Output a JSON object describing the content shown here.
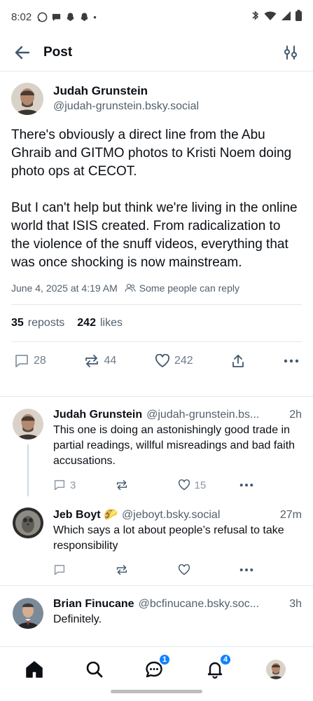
{
  "status_bar": {
    "time": "8:02",
    "dot": "•"
  },
  "header": {
    "title": "Post"
  },
  "main_post": {
    "author_name": "Judah Grunstein",
    "author_handle": "@judah-grunstein.bsky.social",
    "text": "There's obviously a direct line from the Abu Ghraib and GITMO photos to Kristi Noem doing photo ops at CECOT.\n\nBut I can't help but think we're living in the online world that ISIS created. From radicalization to the violence of the snuff videos, everything that was once shocking is now mainstream.",
    "timestamp": "June 4, 2025 at 4:19 AM",
    "reply_setting": "Some people can reply",
    "reposts_count": "35",
    "reposts_label": "reposts",
    "likes_count": "242",
    "likes_label": "likes",
    "actions": {
      "replies": "28",
      "reposts": "44",
      "likes": "242"
    }
  },
  "replies": [
    {
      "name": "Judah Grunstein",
      "handle": "@judah-grunstein.bs...",
      "time": "2h",
      "text": "This one is doing an astonishingly good trade in partial readings, willful misreadings and bad faith accusations.",
      "replies": "3",
      "reposts": "",
      "likes": "15"
    },
    {
      "name": "Jeb Boyt 🌮",
      "handle": "@jeboyt.bsky.social",
      "time": "27m",
      "text": "Which says a lot about people’s refusal to take responsibility",
      "replies": "",
      "reposts": "",
      "likes": ""
    },
    {
      "name": "Brian Finucane",
      "handle": "@bcfinucane.bsky.soc...",
      "time": "3h",
      "text": "Definitely."
    }
  ],
  "bottom_nav": {
    "messages_badge": "1",
    "notifications_badge": "4"
  },
  "colors": {
    "accent": "#1083fe",
    "muted": "#52606d",
    "divider": "#e4e8ec"
  }
}
